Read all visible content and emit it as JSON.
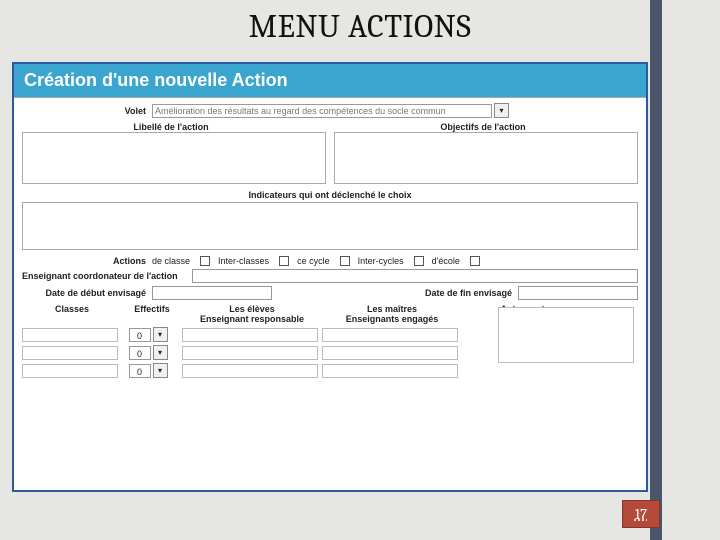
{
  "slide": {
    "title": "MENU ACTIONS",
    "page": "17"
  },
  "form": {
    "header": "Création d'une nouvelle Action",
    "volet": {
      "label": "Volet",
      "value": "Amélioration des résultats au regard des compétences du socle commun"
    },
    "libelle_label": "Libellé de l'action",
    "objectifs_label": "Objectifs de l'action",
    "indicateurs_label": "Indicateurs qui ont déclenché le choix",
    "actions_label": "Actions",
    "checks": {
      "de_classe": "de classe",
      "inter_classes": "Inter-classes",
      "ce_cycle": "ce cycle",
      "inter_cycles": "Inter-cycles",
      "decole": "d'école"
    },
    "coord_label": "Enseignant coordonateur de l'action",
    "date_debut_label": "Date de début envisagé",
    "date_fin_label": "Date de fin envisagé",
    "cols": {
      "classes": "Classes",
      "effectifs": "Effectifs",
      "eleves": "Les élèves",
      "maitres": "Les maîtres",
      "ens_resp": "Enseignant responsable",
      "ens_eng": "Enseignants engagés",
      "autres": "Autres acteurs"
    },
    "rows": [
      {
        "classe": "",
        "effectif": "0",
        "ens_resp": "",
        "ens_eng": ""
      },
      {
        "classe": "",
        "effectif": "0",
        "ens_resp": "",
        "ens_eng": ""
      },
      {
        "classe": "",
        "effectif": "0",
        "ens_resp": "",
        "ens_eng": ""
      }
    ]
  }
}
